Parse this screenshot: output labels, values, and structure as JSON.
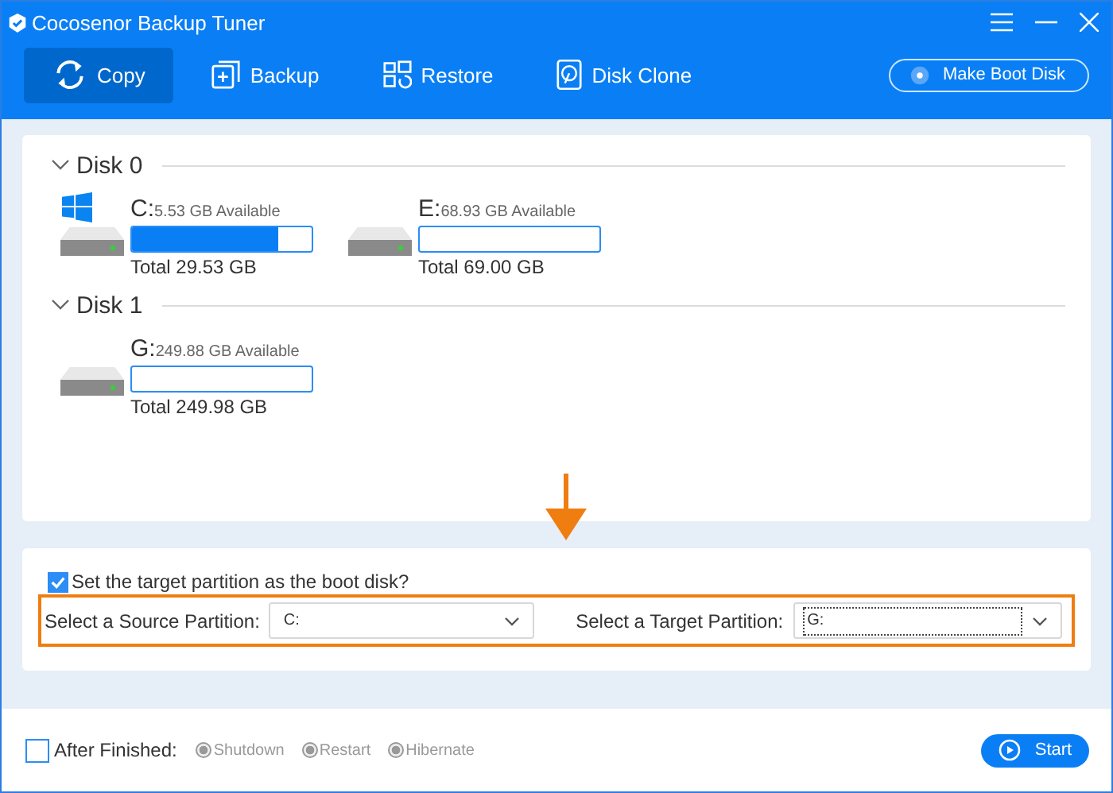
{
  "window": {
    "title": "Cocosenor Backup Tuner"
  },
  "tabs": [
    {
      "label": "Copy",
      "kind": "sync",
      "selected": true
    },
    {
      "label": "Backup",
      "kind": "backup",
      "selected": false
    },
    {
      "label": "Restore",
      "kind": "restore",
      "selected": false
    },
    {
      "label": "Disk Clone",
      "kind": "clone",
      "selected": false
    }
  ],
  "boot_disk_button": "Make Boot Disk",
  "disks": [
    {
      "name": "Disk 0",
      "expanded": true,
      "partitions": [
        {
          "letter": "C:",
          "available": "5.53 GB Available",
          "total": "Total 29.53 GB",
          "level": 0.81,
          "system": true
        },
        {
          "letter": "E:",
          "available": "68.93 GB Available",
          "total": "Total 69.00 GB",
          "level": 0,
          "system": false
        }
      ]
    },
    {
      "name": "Disk 1",
      "expanded": true,
      "partitions": [
        {
          "letter": "G:",
          "available": "249.88 GB Available",
          "total": "Total 249.98 GB",
          "level": 0,
          "system": false
        }
      ]
    }
  ],
  "boot_option": {
    "label": "Set the target partition as the boot disk?",
    "checked": true
  },
  "source": {
    "label": "Select a Source Partition:",
    "value": "C:"
  },
  "target": {
    "label": "Select a Target Partition:",
    "value": "G:"
  },
  "after_finished": {
    "label": "After Finished:",
    "checked": false,
    "options": [
      {
        "label": "Shutdown",
        "disabled": true
      },
      {
        "label": "Restart",
        "disabled": true
      },
      {
        "label": "Hibernate",
        "disabled": true
      }
    ]
  },
  "start_button": "Start"
}
